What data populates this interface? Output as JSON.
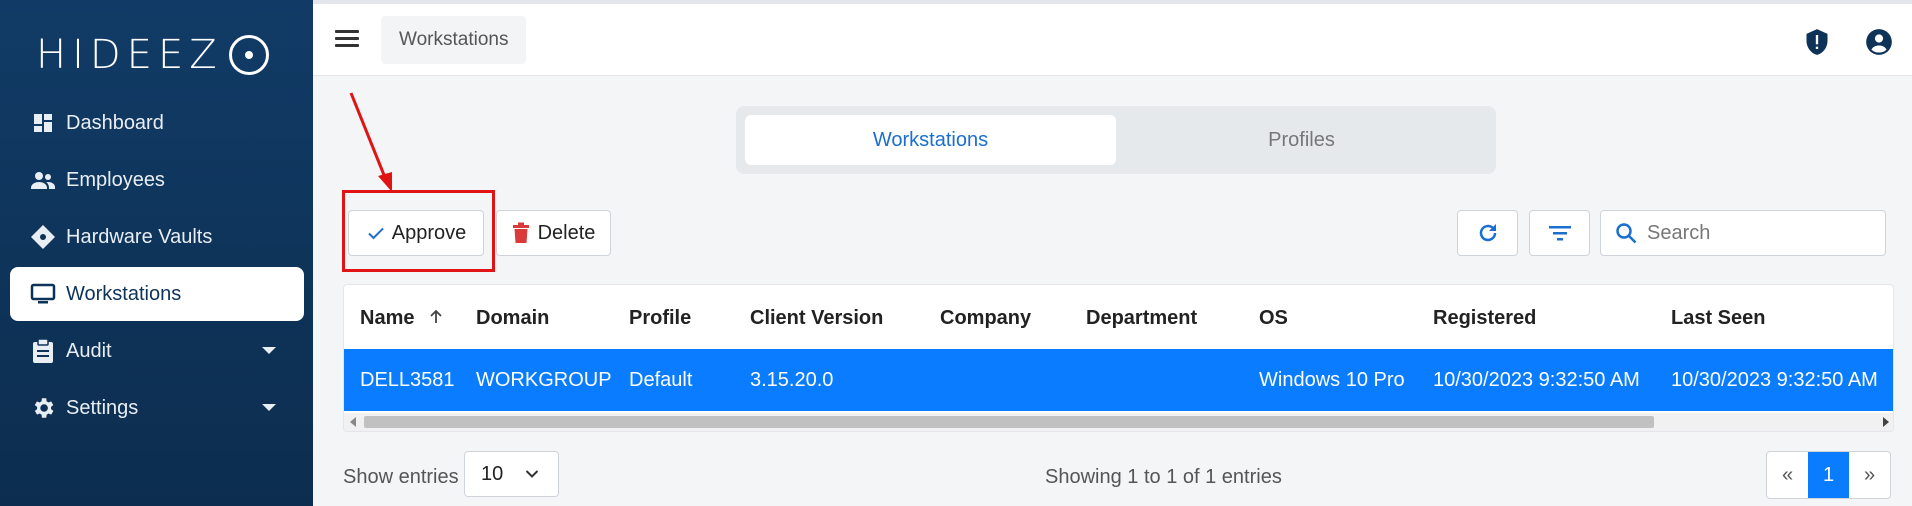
{
  "brand": {
    "logo_text": "HIDEEZ"
  },
  "sidebar": {
    "items": [
      {
        "label": "Dashboard",
        "icon": "dashboard-icon"
      },
      {
        "label": "Employees",
        "icon": "employees-icon"
      },
      {
        "label": "Hardware Vaults",
        "icon": "hardware-vault-icon"
      },
      {
        "label": "Workstations",
        "icon": "monitor-icon",
        "active": true
      },
      {
        "label": "Audit",
        "icon": "clipboard-icon",
        "expandable": true
      },
      {
        "label": "Settings",
        "icon": "gear-icon",
        "expandable": true
      }
    ]
  },
  "header": {
    "breadcrumb": "Workstations",
    "icons": [
      "shield-alert-icon",
      "account-icon"
    ]
  },
  "tabs": [
    {
      "label": "Workstations",
      "active": true
    },
    {
      "label": "Profiles",
      "active": false
    }
  ],
  "toolbar": {
    "approve_label": "Approve",
    "delete_label": "Delete",
    "refresh_icon": "refresh-icon",
    "filter_icon": "filter-icon",
    "search_placeholder": "Search"
  },
  "table": {
    "columns": [
      "Name",
      "Domain",
      "Profile",
      "Client Version",
      "Company",
      "Department",
      "OS",
      "Registered",
      "Last Seen"
    ],
    "sorted_column": "Name",
    "rows": [
      [
        "DELL3581",
        "WORKGROUP",
        "Default",
        "3.15.20.0",
        "",
        "",
        "Windows 10 Pro",
        "10/30/2023 9:32:50 AM",
        "10/30/2023 9:32:50 AM"
      ]
    ]
  },
  "footer": {
    "show_entries_label": "Show entries",
    "entries_value": "10",
    "info": "Showing 1 to 1 of 1 entries",
    "pager": {
      "prev": "«",
      "current": "1",
      "next": "»"
    }
  },
  "colors": {
    "sidebar_bg": "#0e3358",
    "accent": "#0a7cff",
    "annotation": "#e01414",
    "delete": "#d93a3a"
  }
}
